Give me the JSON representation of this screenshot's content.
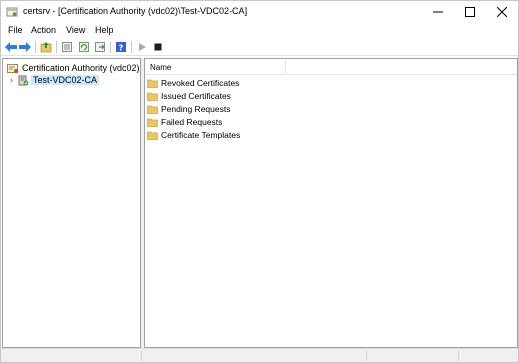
{
  "window": {
    "title": "certsrv - [Certification Authority (vdc02)\\Test-VDC02-CA]",
    "controls": [
      "minimize",
      "maximize",
      "close"
    ]
  },
  "menubar": {
    "items": [
      "File",
      "Action",
      "View",
      "Help"
    ]
  },
  "toolbar": {
    "buttons": [
      "back-arrow-icon",
      "forward-arrow-icon",
      "up-folder-icon",
      "properties-icon",
      "refresh-icon",
      "export-list-icon",
      "help-icon",
      "start-service-icon",
      "stop-service-icon"
    ]
  },
  "tree": {
    "root_label": "Certification Authority (vdc02)",
    "child_label": "Test-VDC02-CA"
  },
  "list": {
    "column_name": "Name",
    "items": [
      "Revoked Certificates",
      "Issued Certificates",
      "Pending Requests",
      "Failed Requests",
      "Certificate Templates"
    ]
  },
  "colors": {
    "selection": "#cce8ff",
    "folder": "#e8c66a",
    "nav_arrow": "#2d7fd3",
    "help_icon": "#3c5ec8"
  }
}
